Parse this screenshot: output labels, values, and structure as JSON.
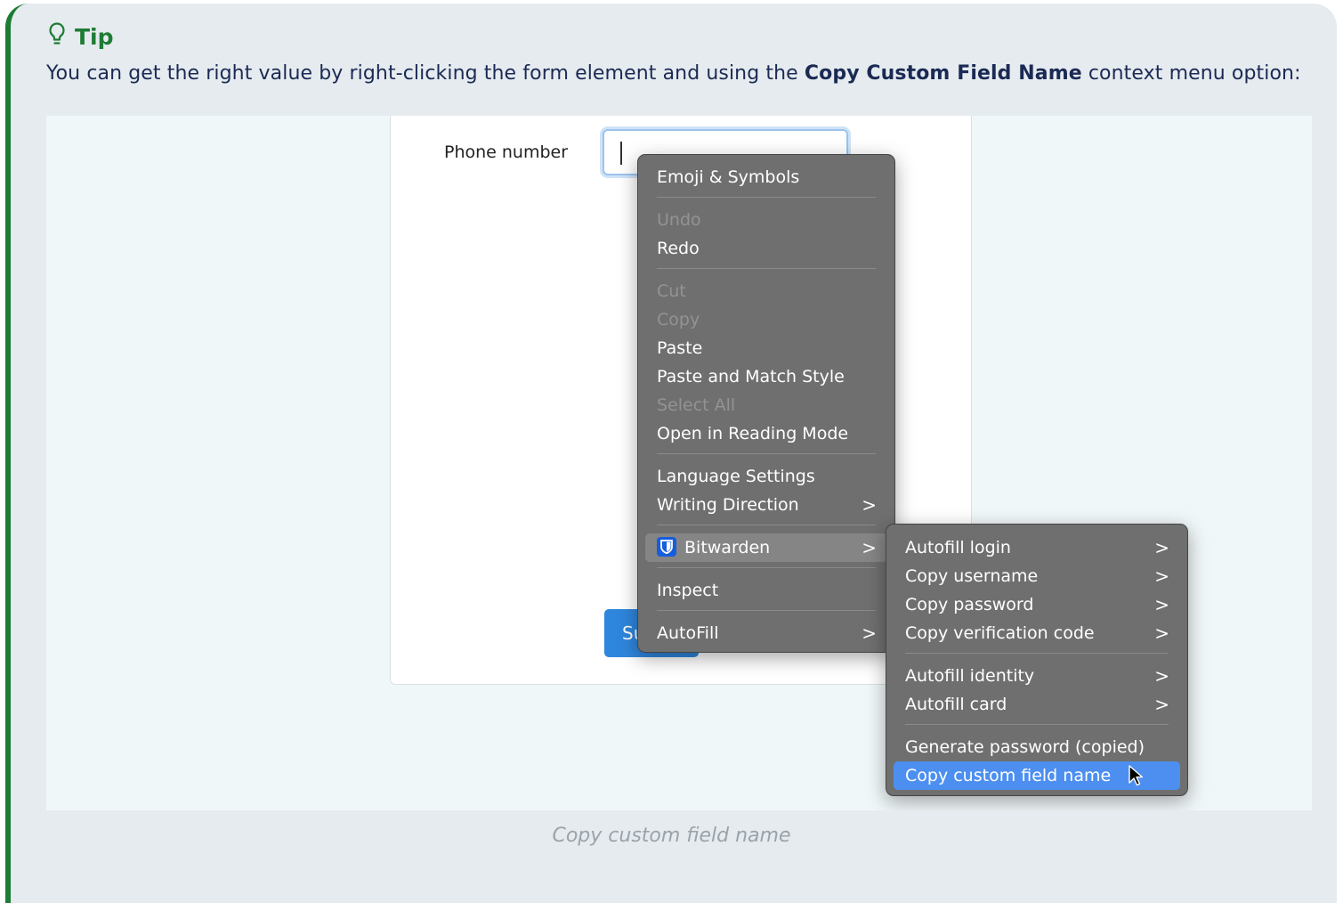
{
  "tip": {
    "title": "Tip",
    "text_before": "You can get the right value by right-clicking the form element and using the ",
    "text_bold": "Copy Custom Field Name",
    "text_after": " context menu option:"
  },
  "form": {
    "phone_label": "Phone number",
    "submit_label": "Submit"
  },
  "context_menu": {
    "emoji": "Emoji & Symbols",
    "undo": "Undo",
    "redo": "Redo",
    "cut": "Cut",
    "copy": "Copy",
    "paste": "Paste",
    "paste_match": "Paste and Match Style",
    "select_all": "Select All",
    "reading_mode": "Open in Reading Mode",
    "language_settings": "Language Settings",
    "writing_direction": "Writing Direction",
    "bitwarden": "Bitwarden",
    "inspect": "Inspect",
    "autofill": "AutoFill",
    "chevron": ">"
  },
  "submenu": {
    "autofill_login": "Autofill login",
    "copy_username": "Copy username",
    "copy_password": "Copy password",
    "copy_totp": "Copy verification code",
    "autofill_identity": "Autofill identity",
    "autofill_card": "Autofill card",
    "generate_password": "Generate password (copied)",
    "copy_custom_field": "Copy custom field name"
  },
  "caption": "Copy custom field name",
  "colors": {
    "tip_accent": "#1e7c34",
    "menu_bg": "#6f6f6f",
    "selected": "#4c8ff0",
    "bitwarden": "#175ddc"
  }
}
